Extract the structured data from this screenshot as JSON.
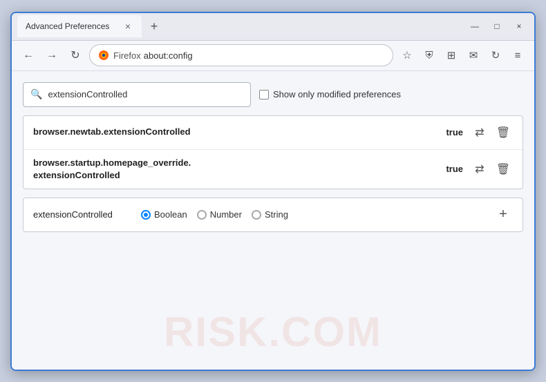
{
  "window": {
    "title": "Advanced Preferences",
    "tab_close": "×",
    "new_tab": "+",
    "minimize": "—",
    "maximize": "□",
    "close": "×"
  },
  "nav": {
    "back_label": "←",
    "forward_label": "→",
    "reload_label": "↻",
    "browser_name": "Firefox",
    "address": "about:config",
    "bookmark_icon": "☆",
    "pocket_icon": "⛨",
    "extension_icon": "⊞",
    "container_icon": "✉",
    "sync_icon": "↻",
    "menu_icon": "≡"
  },
  "search": {
    "placeholder": "extensionControlled",
    "value": "extensionControlled",
    "show_modified_label": "Show only modified preferences"
  },
  "results": [
    {
      "name": "browser.newtab.extensionControlled",
      "value": "true"
    },
    {
      "name_line1": "browser.startup.homepage_override.",
      "name_line2": "extensionControlled",
      "value": "true"
    }
  ],
  "add_pref": {
    "name": "extensionControlled",
    "types": [
      "Boolean",
      "Number",
      "String"
    ],
    "selected_type": "Boolean",
    "add_label": "+"
  },
  "watermark": "RISK.COM",
  "colors": {
    "accent": "#3a7bd5",
    "radio_selected": "#0a84ff"
  }
}
